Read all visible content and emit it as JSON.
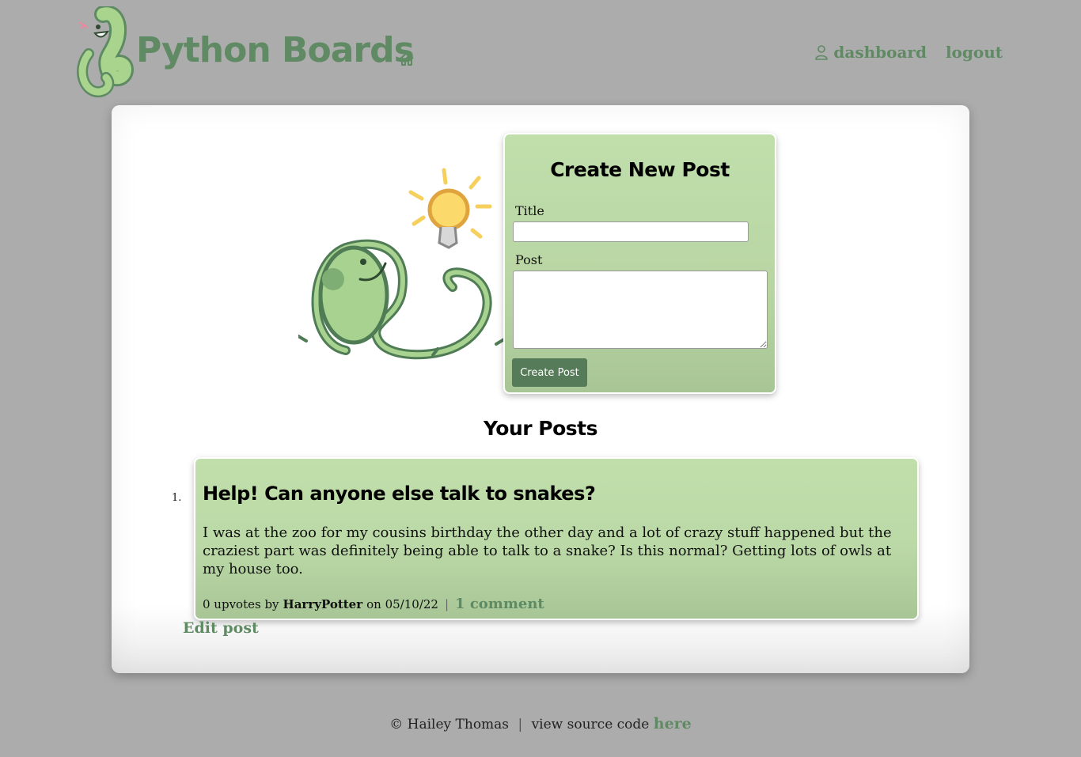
{
  "header": {
    "brand": "Python Boards",
    "nav": [
      {
        "label": "dashboard",
        "icon": "user-icon"
      },
      {
        "label": "logout"
      }
    ]
  },
  "create_form": {
    "heading": "Create New Post",
    "title_label": "Title",
    "title_value": "",
    "post_label": "Post",
    "post_value": "",
    "submit_label": "Create Post"
  },
  "posts_section": {
    "heading": "Your Posts",
    "posts": [
      {
        "number": "1.",
        "title": "Help! Can anyone else talk to snakes?",
        "body": "I was at the zoo for my cousins birthday the other day and a lot of crazy stuff happened but the craziest part was definitely being able to talk to a snake? Is this normal? Getting lots of owls at my house too.",
        "upvotes_text": "0 upvotes by",
        "author": "HarryPotter",
        "date_text": "on 05/10/22",
        "separator": "|",
        "comments_label": "1 comment",
        "edit_label": "Edit post"
      }
    ]
  },
  "footer": {
    "credit": "© Hailey Thomas",
    "separator": "|",
    "source_text": "view source code",
    "source_link": "here"
  },
  "colors": {
    "background": "#acacac",
    "accent_green": "#5f8a63",
    "card_green": "#c0dfab",
    "button_green": "#567b59"
  }
}
